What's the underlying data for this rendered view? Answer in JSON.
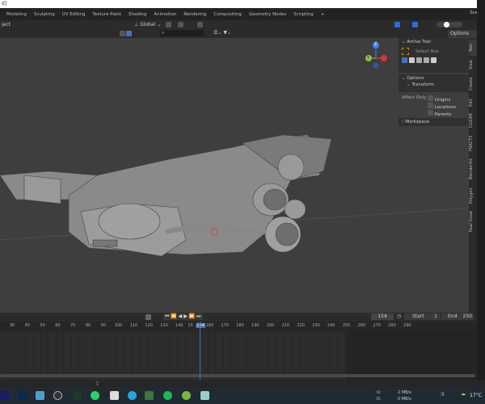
{
  "title": "d]",
  "workspaces": [
    "Modeling",
    "Sculpting",
    "UV Editing",
    "Texture Paint",
    "Shading",
    "Animation",
    "Rendering",
    "Compositing",
    "Geometry Nodes",
    "Scripting",
    "+"
  ],
  "scene": "Scene",
  "header": {
    "mode": "ject",
    "orientation": "Global",
    "options": "Options"
  },
  "npanel": {
    "active_tool": "Active Tool",
    "select_box": "Select Box",
    "options": "Options",
    "transform": "Transform",
    "affect_only": "Affect Only",
    "origins": "Origins",
    "locations": "Locations",
    "parents": "Parents",
    "workspace": "Workspace"
  },
  "tabs": [
    "Tool",
    "View",
    "Create",
    "Edit",
    "CLICKR",
    "FRACTX",
    "BlenderKit",
    "Polygon",
    "Real Snow"
  ],
  "gizmo": {
    "z": "Z",
    "y": "Y"
  },
  "timeline": {
    "current_frame": "154",
    "start_label": "Start",
    "start": "1",
    "end_label": "End",
    "end": "250",
    "ticks": [
      "30",
      "40",
      "50",
      "60",
      "70",
      "80",
      "90",
      "100",
      "110",
      "120",
      "130",
      "140",
      "15",
      "154",
      "160",
      "170",
      "180",
      "190",
      "200",
      "210",
      "220",
      "230",
      "240",
      "250",
      "260",
      "270",
      "280",
      "290"
    ]
  },
  "taskbar": {
    "upload_label": "U:",
    "upload": "2 MB/s",
    "download_label": "D:",
    "download": "0 MB/s",
    "temp": "17°C"
  },
  "colors": {
    "accent": "#4772b3",
    "viewport": "#3e3e3e"
  }
}
